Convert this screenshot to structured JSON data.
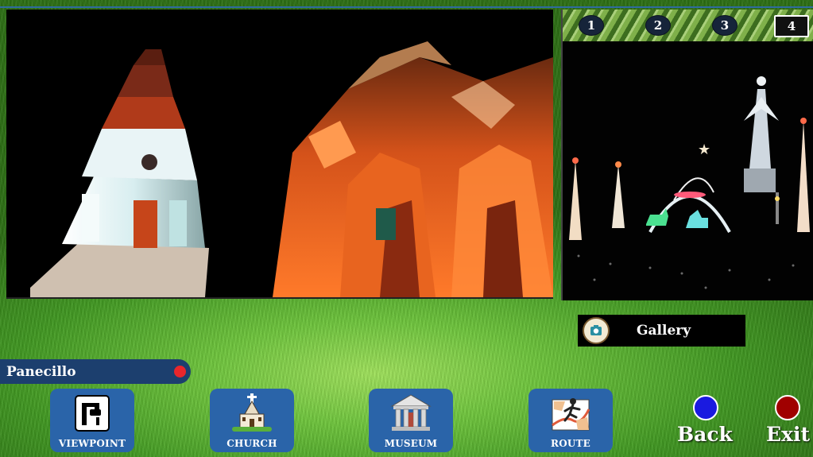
{
  "viewer": {
    "thumbnails": [
      {
        "label": "1"
      },
      {
        "label": "2"
      },
      {
        "label": "3"
      },
      {
        "label": "4"
      }
    ]
  },
  "location": {
    "name": "Panecillo",
    "marker_color": "#e8262b"
  },
  "gallery": {
    "label": "Gallery",
    "icon": "gallery-icon"
  },
  "nav": {
    "viewpoint_label": "VIEWPOINT",
    "church_label": "CHURCH",
    "museum_label": "MUSEUM",
    "route_label": "ROUTE",
    "back_label": "Back",
    "exit_label": "Exit"
  },
  "colors": {
    "nav_button": "#2a64a9",
    "location_bar": "#1c3f6e",
    "back_button": "#1a1ae0",
    "exit_button": "#a00000"
  }
}
